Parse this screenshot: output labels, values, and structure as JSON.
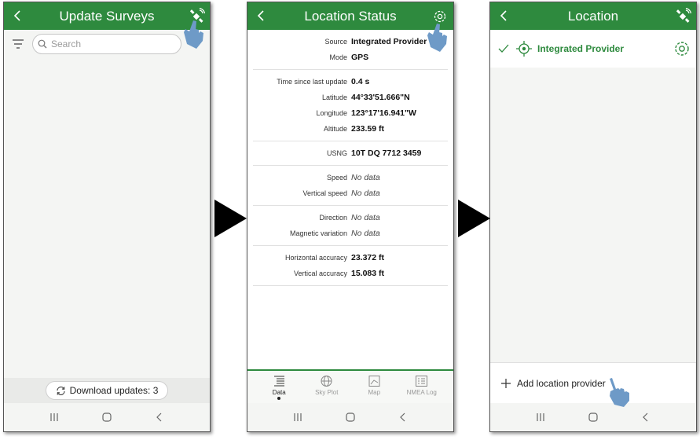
{
  "panel1": {
    "title": "Update Surveys",
    "search_placeholder": "Search",
    "download_label": "Download updates: 3",
    "icons": [
      "back-arrow-icon",
      "satellite-icon",
      "filter-icon",
      "search-icon",
      "sync-icon"
    ]
  },
  "panel2": {
    "title": "Location Status",
    "groups": [
      [
        {
          "label": "Source",
          "value": "Integrated Provider"
        },
        {
          "label": "Mode",
          "value": "GPS"
        }
      ],
      [
        {
          "label": "Time since last update",
          "value": "0.4 s"
        },
        {
          "label": "Latitude",
          "value": "44°33'51.666\"N"
        },
        {
          "label": "Longitude",
          "value": "123°17'16.941\"W"
        },
        {
          "label": "Altitude",
          "value": "233.59 ft"
        }
      ],
      [
        {
          "label": "USNG",
          "value": "10T DQ 7712 3459"
        }
      ],
      [
        {
          "label": "Speed",
          "value": "No data"
        },
        {
          "label": "Vertical speed",
          "value": "No data"
        }
      ],
      [
        {
          "label": "Direction",
          "value": "No data"
        },
        {
          "label": "Magnetic variation",
          "value": "No data"
        }
      ],
      [
        {
          "label": "Horizontal accuracy",
          "value": "23.372 ft"
        },
        {
          "label": "Vertical accuracy",
          "value": "15.083 ft"
        }
      ]
    ],
    "tabs": [
      {
        "label": "Data",
        "icon": "data-list-icon",
        "active": true
      },
      {
        "label": "Sky Plot",
        "icon": "sky-plot-icon",
        "active": false
      },
      {
        "label": "Map",
        "icon": "map-icon",
        "active": false
      },
      {
        "label": "NMEA Log",
        "icon": "nmea-log-icon",
        "active": false
      }
    ]
  },
  "panel3": {
    "title": "Location",
    "provider_name": "Integrated Provider",
    "add_label": "Add location provider"
  },
  "colors": {
    "brand": "#2e8a3e",
    "hand": "#6e9ac7",
    "no_data": "No data"
  }
}
